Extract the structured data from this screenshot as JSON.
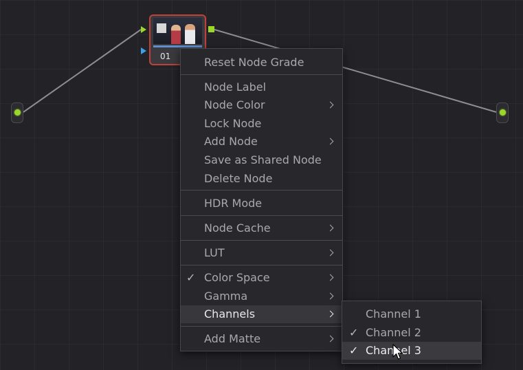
{
  "node": {
    "label": "01",
    "border_color": "#c0413a"
  },
  "colors": {
    "accent_green": "#9bd62a",
    "accent_blue": "#3ea0e8",
    "menu_bg": "#28282c",
    "text": "#a9a9ad"
  },
  "icons": {
    "check": "✓",
    "submenu": "chevron-right-icon"
  },
  "menu": {
    "items": [
      {
        "label": "Reset Node Grade"
      },
      {
        "label": "Node Label"
      },
      {
        "label": "Node Color"
      },
      {
        "label": "Lock Node"
      },
      {
        "label": "Add Node"
      },
      {
        "label": "Save as Shared Node"
      },
      {
        "label": "Delete Node"
      },
      {
        "label": "HDR Mode"
      },
      {
        "label": "Node Cache"
      },
      {
        "label": "LUT"
      },
      {
        "label": "Color Space"
      },
      {
        "label": "Gamma"
      },
      {
        "label": "Channels"
      },
      {
        "label": "Add Matte"
      }
    ]
  },
  "submenu": {
    "items": [
      {
        "label": "Channel 1"
      },
      {
        "label": "Channel 2"
      },
      {
        "label": "Channel 3"
      }
    ]
  }
}
